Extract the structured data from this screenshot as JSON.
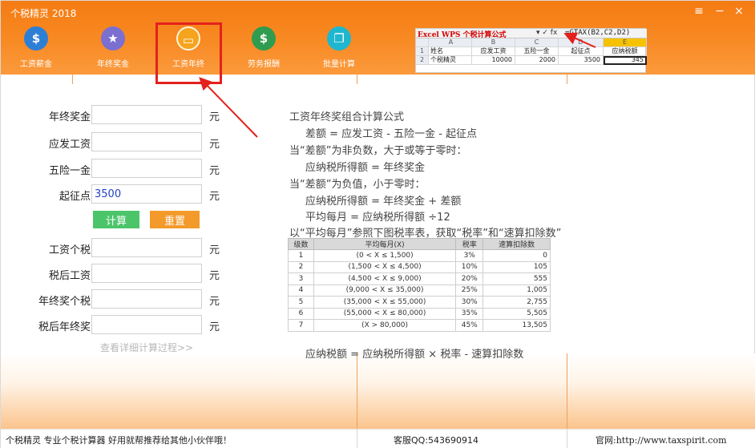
{
  "window": {
    "title": "个税精灵 2018",
    "menu_icon": "≡",
    "min_icon": "−",
    "close_icon": "×"
  },
  "toolbar": [
    {
      "label": "工资薪金",
      "icon": "money-bag-icon",
      "glyph": "$"
    },
    {
      "label": "年终奖金",
      "icon": "bonus-card-icon",
      "glyph": "★"
    },
    {
      "label": "工资年终",
      "icon": "wallet-icon",
      "glyph": "▭"
    },
    {
      "label": "劳务报酬",
      "icon": "coins-icon",
      "glyph": "$"
    },
    {
      "label": "批量计算",
      "icon": "batch-copy-icon",
      "glyph": "❐"
    }
  ],
  "excel": {
    "title": "Excel WPS 个税计算公式",
    "fx": "▾ ✓ fx",
    "formula": "=GTAX(B2,C2,D2)",
    "col_headers": [
      "",
      "A",
      "B",
      "C",
      "D",
      "E"
    ],
    "row1": [
      "1",
      "姓名",
      "应发工资",
      "五险一金",
      "起征点",
      "应纳税额"
    ],
    "row2": [
      "2",
      "个税精灵",
      "10000",
      "2000",
      "3500",
      "345"
    ]
  },
  "form": {
    "fields": [
      {
        "label": "年终奖金",
        "value": "",
        "unit": "元"
      },
      {
        "label": "应发工资",
        "value": "",
        "unit": "元"
      },
      {
        "label": "五险一金",
        "value": "",
        "unit": "元"
      },
      {
        "label": "起征点",
        "value": "3500",
        "unit": "元"
      }
    ],
    "results": [
      {
        "label": "工资个税",
        "value": "",
        "unit": "元"
      },
      {
        "label": "税后工资",
        "value": "",
        "unit": "元"
      },
      {
        "label": "年终奖个税",
        "value": "",
        "unit": "元"
      },
      {
        "label": "税后年终奖",
        "value": "",
        "unit": "元"
      }
    ],
    "calc_label": "计算",
    "reset_label": "重置",
    "detail_link": "查看详细计算过程>>"
  },
  "explanation": {
    "lines": [
      "工资年终奖组合计算公式",
      "差额 =  应发工资  - 五险一金 - 起征点",
      "当“差额”为非负数，大于或等于零时：",
      "应纳税所得额 = 年终奖金",
      "当“差额”为负值，小于零时：",
      "应纳税所得额 = 年终奖金 + 差额",
      "平均每月 = 应纳税所得额 ÷12",
      "以“平均每月”参照下图税率表，获取“税率”和“速算扣除数”"
    ],
    "footer": "应纳税额 = 应纳税所得额 × 税率 - 速算扣除数"
  },
  "rate_table": {
    "headers": [
      "级数",
      "平均每月(X)",
      "税率",
      "速算扣除数"
    ],
    "rows": [
      [
        "1",
        "(0 < X ≤ 1,500)",
        "3%",
        "0"
      ],
      [
        "2",
        "(1,500 < X ≤ 4,500)",
        "10%",
        "105"
      ],
      [
        "3",
        "(4,500 < X ≤ 9,000)",
        "20%",
        "555"
      ],
      [
        "4",
        "(9,000 < X ≤ 35,000)",
        "25%",
        "1,005"
      ],
      [
        "5",
        "(35,000 < X ≤ 55,000)",
        "30%",
        "2,755"
      ],
      [
        "6",
        "(55,000 < X ≤ 80,000)",
        "35%",
        "5,505"
      ],
      [
        "7",
        "(X > 80,000)",
        "45%",
        "13,505"
      ]
    ]
  },
  "status": {
    "left": "个税精灵 专业个税计算器 好用就帮推荐给其他小伙伴哦！",
    "mid": "客服QQ:543690914",
    "right": "官网:http://www.taxspirit.com"
  },
  "colors": {
    "accent": "#f57b12",
    "highlight": "#e3211d",
    "calc": "#4cc56a",
    "reset": "#f39a2a"
  }
}
